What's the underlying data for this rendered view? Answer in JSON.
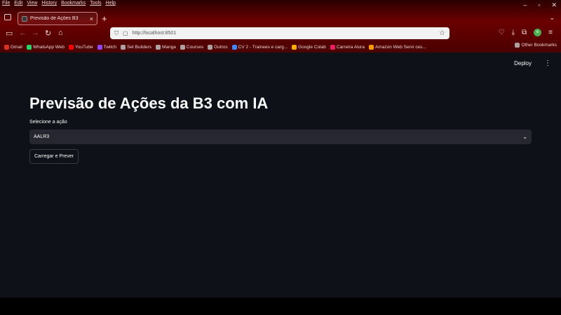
{
  "browser": {
    "menu": [
      "File",
      "Edit",
      "View",
      "History",
      "Bookmarks",
      "Tools",
      "Help"
    ],
    "window_controls": [
      "–",
      "▫",
      "✕"
    ],
    "tab_title": "Previsão de Ações B3",
    "url": "http://localhost:8501",
    "bookmarks": [
      {
        "label": "Gmail",
        "color": "#d93025"
      },
      {
        "label": "WhatsApp Web",
        "color": "#25d366"
      },
      {
        "label": "YouTube",
        "color": "#ff0000"
      },
      {
        "label": "Twitch",
        "color": "#9146ff"
      },
      {
        "label": "Set Builders",
        "color": "#b0a0a0"
      },
      {
        "label": "Manga",
        "color": "#b0a0a0"
      },
      {
        "label": "Courses",
        "color": "#b0a0a0"
      },
      {
        "label": "Outros",
        "color": "#b0a0a0"
      },
      {
        "label": "CV 2 - Trainees e carg...",
        "color": "#4285f4"
      },
      {
        "label": "Google Colab",
        "color": "#f9ab00"
      },
      {
        "label": "Carreira Alura",
        "color": "#e91e63"
      },
      {
        "label": "Amazon Web Servi ces...",
        "color": "#ff9900"
      }
    ],
    "other_bookmarks": "Other Bookmarks"
  },
  "app": {
    "deploy_label": "Deploy",
    "title": "Previsão de Ações da B3 com IA",
    "select_label": "Selecione a ação",
    "select_value": "AALR3",
    "button_label": "Carregar e Prever"
  }
}
